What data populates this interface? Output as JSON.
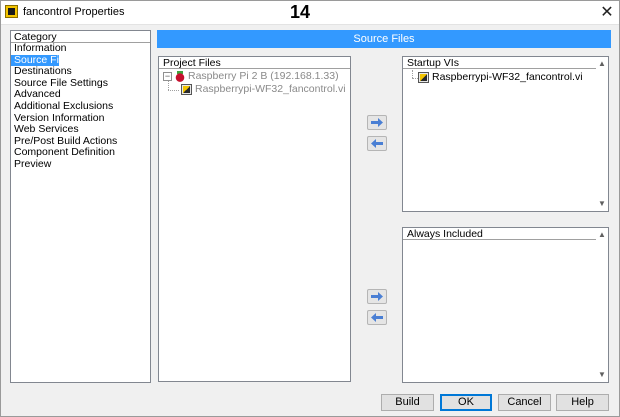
{
  "window": {
    "title": "fancontrol Properties",
    "annotation": "14",
    "close_glyph": "✕"
  },
  "category": {
    "header": "Category",
    "items": [
      "Information",
      "Source Files",
      "Destinations",
      "Source File Settings",
      "Advanced",
      "Additional Exclusions",
      "Version Information",
      "Web Services",
      "Pre/Post Build Actions",
      "Component Definition",
      "Preview"
    ],
    "selected_index": 1
  },
  "banner": {
    "title": "Source Files"
  },
  "project_files": {
    "header": "Project Files",
    "target": "Raspberry Pi 2 B (192.168.1.33)",
    "target_icon": "raspberry-pi-icon",
    "vi": "Raspberrypi-WF32_fancontrol.vi",
    "vi_icon": "labview-vi-icon"
  },
  "startup_vis": {
    "header": "Startup VIs",
    "items": [
      "Raspberrypi-WF32_fancontrol.vi"
    ]
  },
  "always_included": {
    "header": "Always Included",
    "items": []
  },
  "arrows": {
    "add_icon": "arrow-right-icon",
    "remove_icon": "arrow-left-icon",
    "color": "#4a7fd4"
  },
  "buttons": {
    "build": "Build",
    "ok": "OK",
    "cancel": "Cancel",
    "help": "Help"
  },
  "colors": {
    "accent": "#3399ff",
    "disabled_text": "#8a8a8a"
  }
}
